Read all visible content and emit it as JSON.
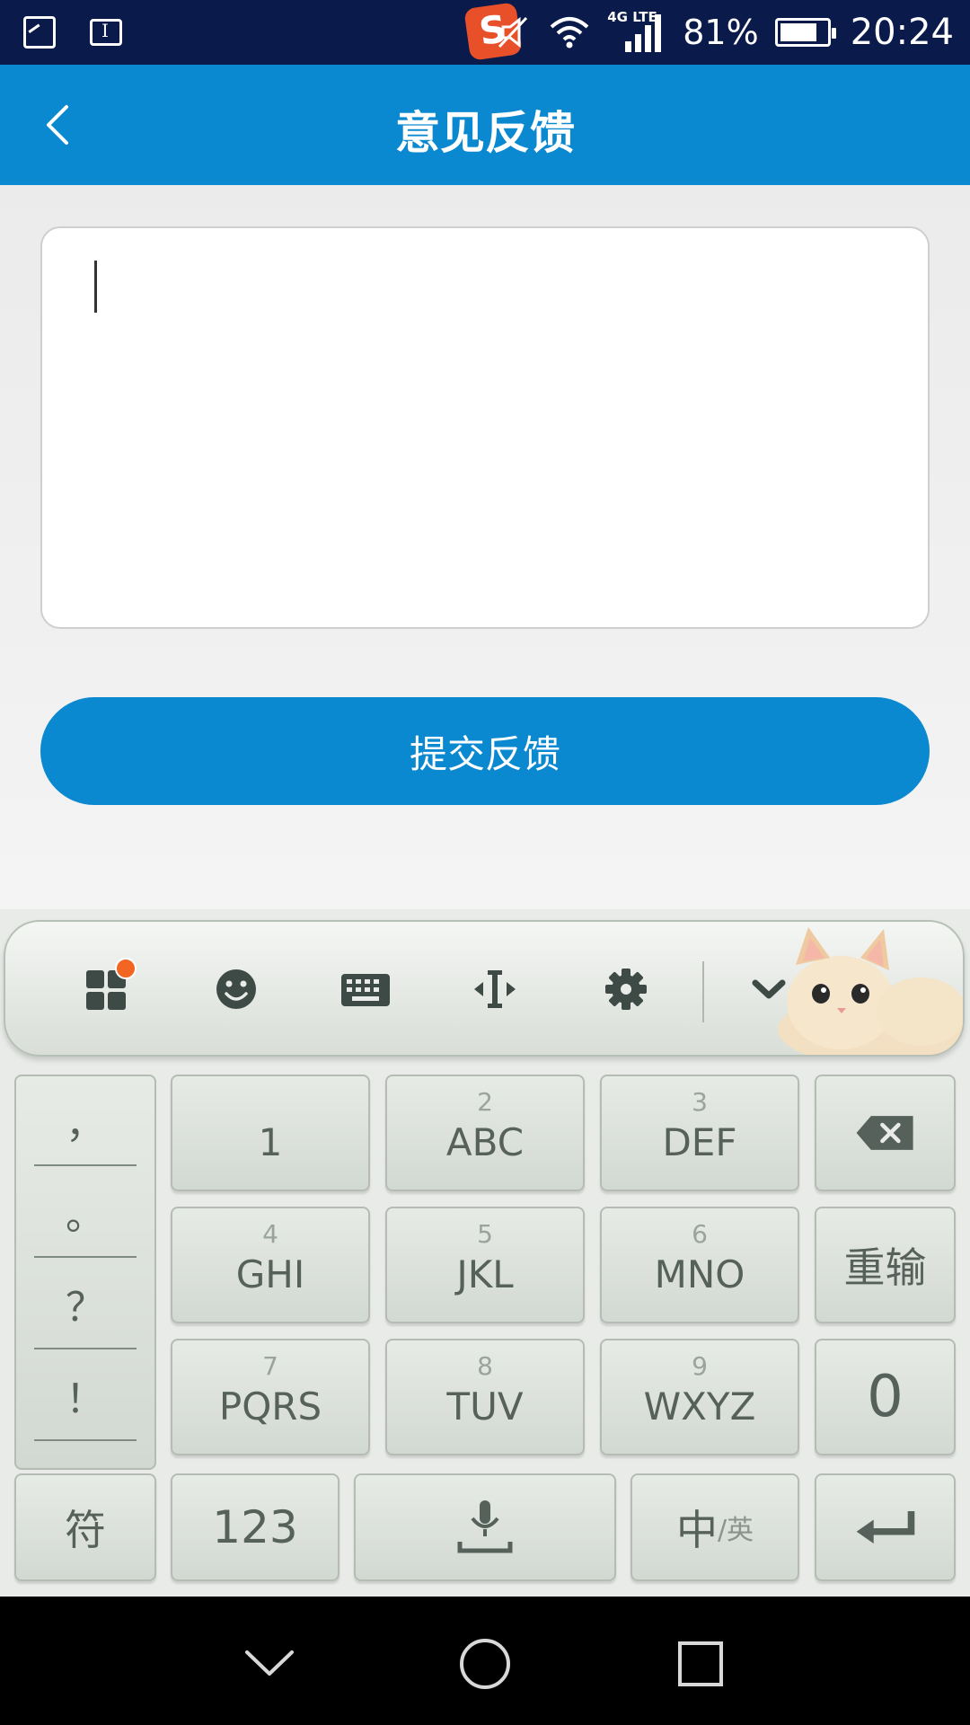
{
  "status_bar": {
    "left_icons": [
      "image-icon",
      "text-icon"
    ],
    "sogou_badge": "S",
    "network_tag": "4G LTE",
    "battery_percent": "81%",
    "battery_level": 0.81,
    "time": "20:24"
  },
  "header": {
    "title": "意见反馈",
    "back_icon": "chevron-left-icon"
  },
  "feedback": {
    "input_value": "",
    "input_placeholder": "",
    "submit_label": "提交反馈"
  },
  "keyboard": {
    "toolbar": {
      "icons": [
        "apps-grid-icon",
        "emoji-icon",
        "keyboard-icon",
        "cursor-move-icon",
        "settings-icon",
        "chevron-down-icon"
      ],
      "notification_dot_color": "#f26522"
    },
    "punctuation": [
      "，",
      "。",
      "？",
      "！"
    ],
    "keys": {
      "k1": {
        "main": "1"
      },
      "k2": {
        "num": "2",
        "main": "ABC"
      },
      "k3": {
        "num": "3",
        "main": "DEF"
      },
      "k4": {
        "num": "4",
        "main": "GHI"
      },
      "k5": {
        "num": "5",
        "main": "JKL"
      },
      "k6": {
        "num": "6",
        "main": "MNO"
      },
      "k7": {
        "num": "7",
        "main": "PQRS"
      },
      "k8": {
        "num": "8",
        "main": "TUV"
      },
      "k9": {
        "num": "9",
        "main": "WXYZ"
      },
      "k0": {
        "main": "0"
      }
    },
    "reenter_label": "重输",
    "symbol_label": "符",
    "numbers_label": "123",
    "lang_main": "中",
    "lang_sub": "/英"
  },
  "nav_bar": {
    "icons": [
      "back-chevron-icon",
      "home-circle-icon",
      "recents-square-icon"
    ]
  },
  "colors": {
    "status_bar_bg": "#0a1a4a",
    "accent_blue": "#0a88d0",
    "keyboard_bg": "#e8ebe8",
    "key_text": "#56615c"
  }
}
